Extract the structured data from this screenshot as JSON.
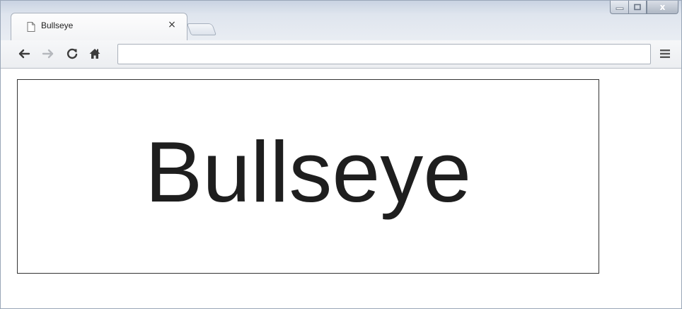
{
  "tab": {
    "title": "Bullseye",
    "close_glyph": "×"
  },
  "window_controls": {
    "close_glyph": "x"
  },
  "toolbar": {
    "back_icon": "back-arrow-icon",
    "forward_icon": "forward-arrow-icon",
    "reload_icon": "reload-icon",
    "home_icon": "home-icon",
    "address_value": "",
    "menu_icon": "menu-icon"
  },
  "page": {
    "heading": "Bullseye"
  },
  "colors": {
    "frame": "#c9d3e2",
    "page_background": "#ffffff",
    "box_border": "#333333",
    "text": "#1e1e1e"
  }
}
